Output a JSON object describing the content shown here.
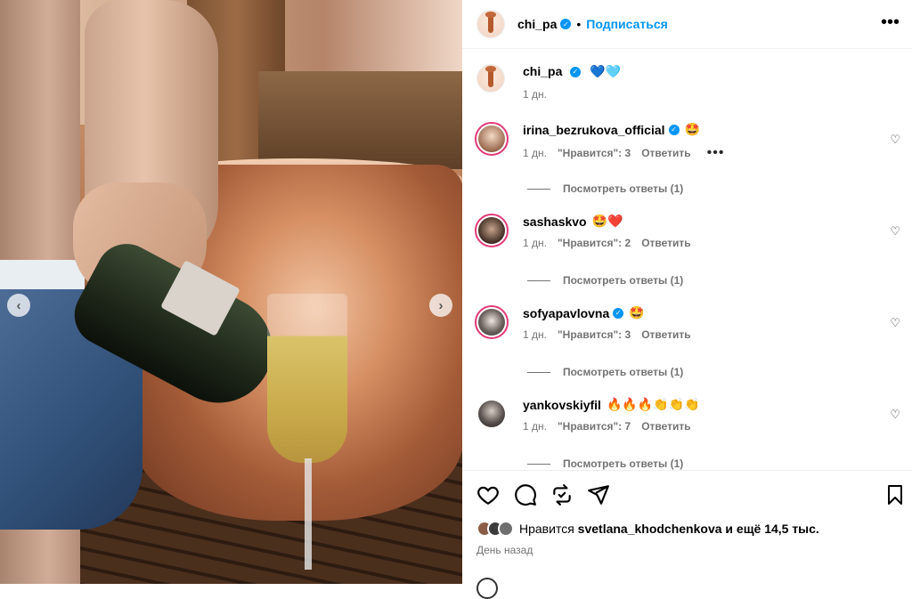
{
  "post": {
    "author": "chi_pa",
    "follow_label": "Подписаться",
    "more_icon": "more-horizontal-icon",
    "prev_arrow": "‹",
    "next_arrow": "›"
  },
  "caption": {
    "username": "chi_pa",
    "text": "💙🩵",
    "time": "1 дн."
  },
  "comments": [
    {
      "username": "irina_bezrukova_official",
      "verified": true,
      "text": "🤩",
      "time": "1 дн.",
      "likes": "\"Нравится\": 3",
      "reply": "Ответить",
      "more": "•••",
      "view_replies": "Посмотреть ответы (1)"
    },
    {
      "username": "sashaskvo",
      "verified": false,
      "text": "🤩❤️",
      "time": "1 дн.",
      "likes": "\"Нравится\": 2",
      "reply": "Ответить",
      "view_replies": "Посмотреть ответы (1)"
    },
    {
      "username": "sofyapavlovna",
      "verified": true,
      "text": "🤩",
      "time": "1 дн.",
      "likes": "\"Нравится\": 3",
      "reply": "Ответить",
      "view_replies": "Посмотреть ответы (1)"
    },
    {
      "username": "yankovskiyfil",
      "verified": false,
      "text": "🔥🔥🔥👏👏👏",
      "time": "1 дн.",
      "likes": "\"Нравится\": 7",
      "reply": "Ответить",
      "view_replies": "Посмотреть ответы (1)"
    }
  ],
  "likes": {
    "prefix": "Нравится",
    "user": "svetlana_khodchenkova",
    "suffix": "и ещё 14,5 тыс."
  },
  "date": "День назад",
  "colors": {
    "accent": "#0095f6",
    "story_ring": "#e23a76",
    "muted_text": "#737373"
  }
}
